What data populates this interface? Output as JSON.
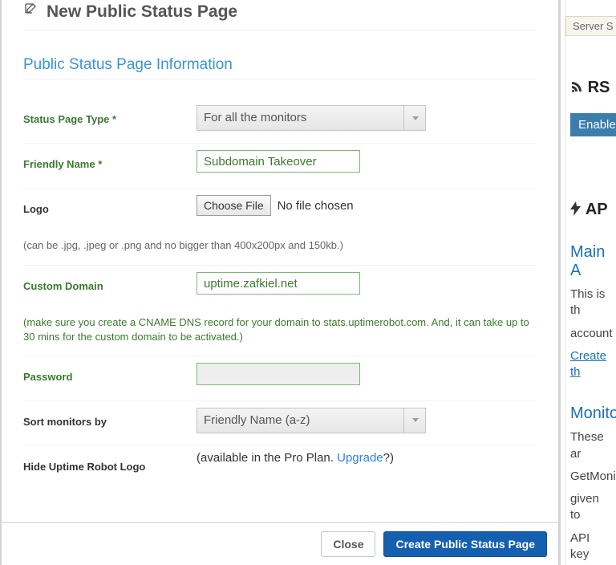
{
  "modal": {
    "title": "New Public Status Page",
    "section_title": "Public Status Page Information",
    "fields": {
      "status_type": {
        "label": "Status Page Type *",
        "value": "For all the monitors"
      },
      "friendly_name": {
        "label": "Friendly Name *",
        "value": "Subdomain Takeover"
      },
      "logo": {
        "label": "Logo",
        "button": "Choose File",
        "status": "No file chosen",
        "hint": "(can be .jpg, .jpeg or .png and no bigger than 400x200px and 150kb.)"
      },
      "custom_domain": {
        "label": "Custom Domain",
        "value": "uptime.zafkiel.net",
        "hint": "(make sure you create a CNAME DNS record for your domain to stats.uptimerobot.com. And, it can take up to 30 mins for the custom domain to be activated.)"
      },
      "password": {
        "label": "Password",
        "value": ""
      },
      "sort": {
        "label": "Sort monitors by",
        "value": "Friendly Name (a-z)"
      },
      "hide_logo": {
        "label": "Hide Uptime Robot Logo",
        "msg_pre": "(available in the Pro Plan. ",
        "link": "Upgrade",
        "msg_post": "?)"
      }
    },
    "footer": {
      "close": "Close",
      "create": "Create Public Status Page"
    }
  },
  "back": {
    "server_box": "Server S",
    "rss_title": "RS",
    "enable": "Enable",
    "api_title": "AP",
    "main_api": "Main A",
    "main_api_p1": "This is th",
    "main_api_p2": "account",
    "main_api_link": "Create th",
    "monitor": "Monito",
    "monitor_p1": "These ar",
    "monitor_p2": "GetMoni",
    "monitor_p3": "given to",
    "monitor_p4": "API key"
  }
}
